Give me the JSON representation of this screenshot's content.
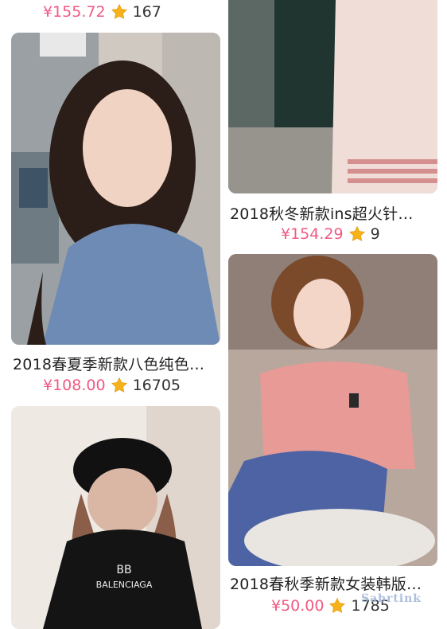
{
  "products": [
    {
      "title": "",
      "price": "¥155.72",
      "count": "167"
    },
    {
      "title": "2018春夏季新款八色纯色…",
      "price": "¥108.00",
      "count": "16705"
    },
    {
      "title": "",
      "price": "",
      "count": ""
    },
    {
      "title": "2018秋冬新款ins超火针…",
      "price": "¥154.29",
      "count": "9"
    },
    {
      "title": "2018春秋季新款女装韩版…",
      "price": "¥50.00",
      "count": "1785"
    }
  ],
  "watermark": "Sabrtink",
  "colors": {
    "price": "#f05a84",
    "star": "#f6b21b",
    "text": "#222222"
  },
  "icons": {
    "rating": "star-icon"
  }
}
